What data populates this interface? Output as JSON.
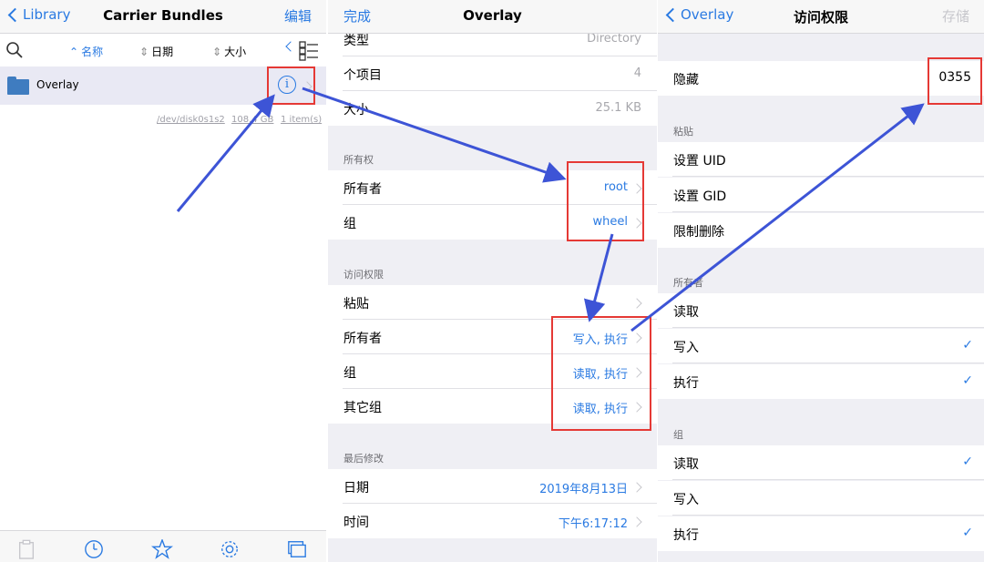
{
  "panel1": {
    "back_label": "Library",
    "title": "Carrier Bundles",
    "edit_label": "编辑",
    "sort": {
      "name": "名称",
      "date": "日期",
      "size": "大小"
    },
    "file_name": "Overlay",
    "info_glyph": "i",
    "footnote": {
      "disk": "/dev/disk0s1s2",
      "size": "108.4 GB",
      "count": "1 item(s)"
    },
    "icons": [
      "search-icon",
      "grid-view-icon",
      "clipboard-icon",
      "history-icon",
      "favorites-star-icon",
      "settings-gear-icon",
      "windows-icon"
    ]
  },
  "panel2": {
    "done_label": "完成",
    "title": "Overlay",
    "rows_top": [
      {
        "label": "类型",
        "value": "Directory"
      },
      {
        "label": "个项目",
        "value": "4"
      },
      {
        "label": "大小",
        "value": "25.1 KB"
      }
    ],
    "ownership_header": "所有权",
    "ownership": [
      {
        "label": "所有者",
        "value": "root"
      },
      {
        "label": "组",
        "value": "wheel"
      }
    ],
    "permissions_header": "访问权限",
    "permissions": [
      {
        "label": "粘贴",
        "value": ""
      },
      {
        "label": "所有者",
        "value": "写入, 执行"
      },
      {
        "label": "组",
        "value": "读取, 执行"
      },
      {
        "label": "其它组",
        "value": "读取, 执行"
      }
    ],
    "modified_header": "最后修改",
    "modified": [
      {
        "label": "日期",
        "value": "2019年8月13日"
      },
      {
        "label": "时间",
        "value": "下午6:17:12"
      }
    ]
  },
  "panel3": {
    "back_label": "Overlay",
    "title": "访问权限",
    "save_label": "存储",
    "hidden_label": "隐藏",
    "octal": "0355",
    "special_header": "粘贴",
    "special": [
      "设置 UID",
      "设置 GID",
      "限制删除"
    ],
    "owner_header": "所有者",
    "owner": [
      {
        "label": "读取",
        "checked": false
      },
      {
        "label": "写入",
        "checked": true
      },
      {
        "label": "执行",
        "checked": true
      }
    ],
    "group_header": "组",
    "group": [
      {
        "label": "读取",
        "checked": true
      },
      {
        "label": "写入",
        "checked": false
      },
      {
        "label": "执行",
        "checked": true
      }
    ],
    "check_glyph": "✓"
  },
  "colors": {
    "accent": "#2a7ae2",
    "highlight": "#e53935",
    "annotation_arrow": "#3d54d6"
  }
}
